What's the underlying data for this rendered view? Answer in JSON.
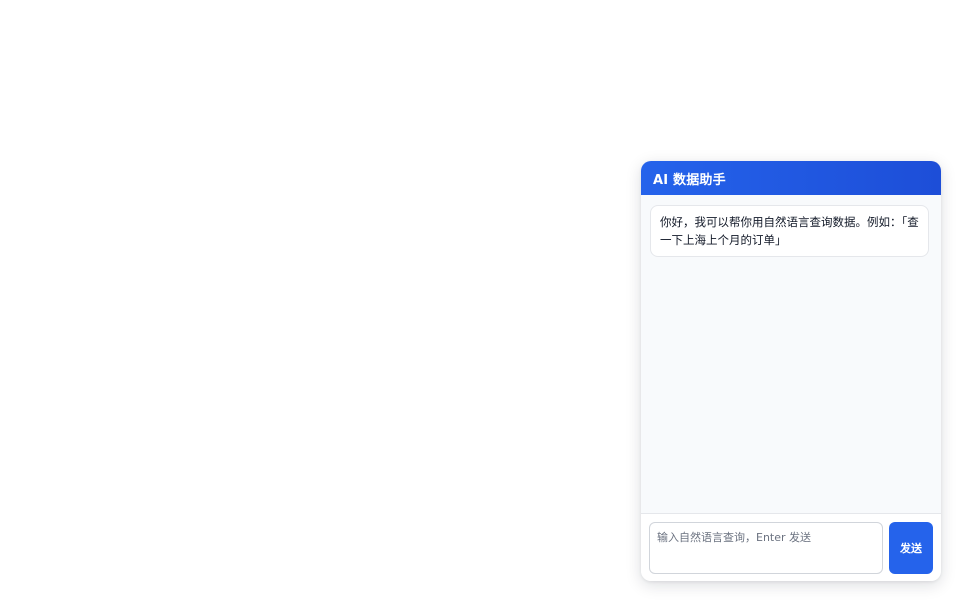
{
  "assistant": {
    "title": "AI 数据助手",
    "messages": [
      {
        "role": "assistant",
        "text": "你好，我可以帮你用自然语言查询数据。例如：「查一下上海上个月的订单」"
      }
    ],
    "input": {
      "value": "",
      "placeholder": "输入自然语言查询，Enter 发送"
    },
    "send_label": "发送"
  },
  "colors": {
    "accent": "#2563eb",
    "panel_background": "#f8fafc",
    "bubble_background": "#ffffff"
  }
}
